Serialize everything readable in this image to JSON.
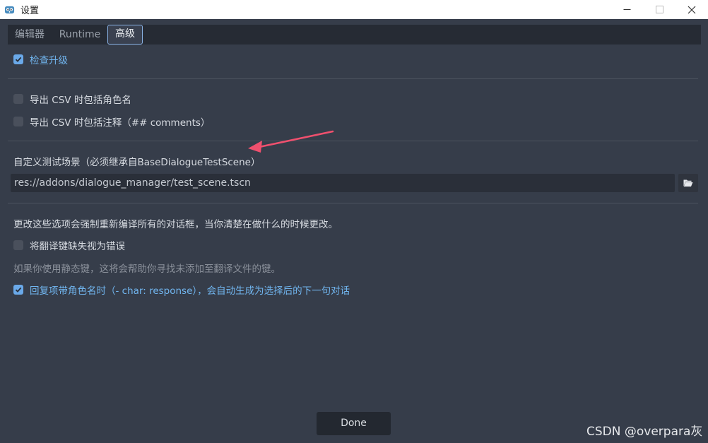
{
  "window": {
    "title": "设置",
    "controls": [
      "minimize",
      "maximize",
      "close"
    ]
  },
  "tabs": [
    {
      "label": "编辑器",
      "active": false
    },
    {
      "label": "Runtime",
      "active": false
    },
    {
      "label": "高级",
      "active": true
    }
  ],
  "settings": {
    "check_upgrade": {
      "label": "检查升级",
      "checked": true
    },
    "csv_character_names": {
      "label": "导出 CSV 时包括角色名",
      "checked": false
    },
    "csv_comments": {
      "label": "导出 CSV 时包括注释（## comments）",
      "checked": false
    },
    "test_scene": {
      "label": "自定义测试场景（必须继承自BaseDialogueTestScene）",
      "value": "res://addons/dialogue_manager/test_scene.tscn"
    },
    "recompile_note": "更改这些选项会强制重新编译所有的对话框，当你清楚在做什么的时候更改。",
    "missing_keys_as_errors": {
      "label": "将翻译键缺失视为错误",
      "checked": false
    },
    "missing_keys_hint": "如果你使用静态键，这将会帮助你寻找未添加至翻译文件的键。",
    "auto_response_ids": {
      "label": "回复项带角色名时（- char: response），会自动生成为选择后的下一句对话",
      "checked": true
    }
  },
  "footer": {
    "done_label": "Done"
  },
  "watermark": "CSDN @overpara灰",
  "colors": {
    "accent": "#6aa9e9",
    "background": "#363d4a",
    "annotation_arrow": "#f0506e"
  }
}
